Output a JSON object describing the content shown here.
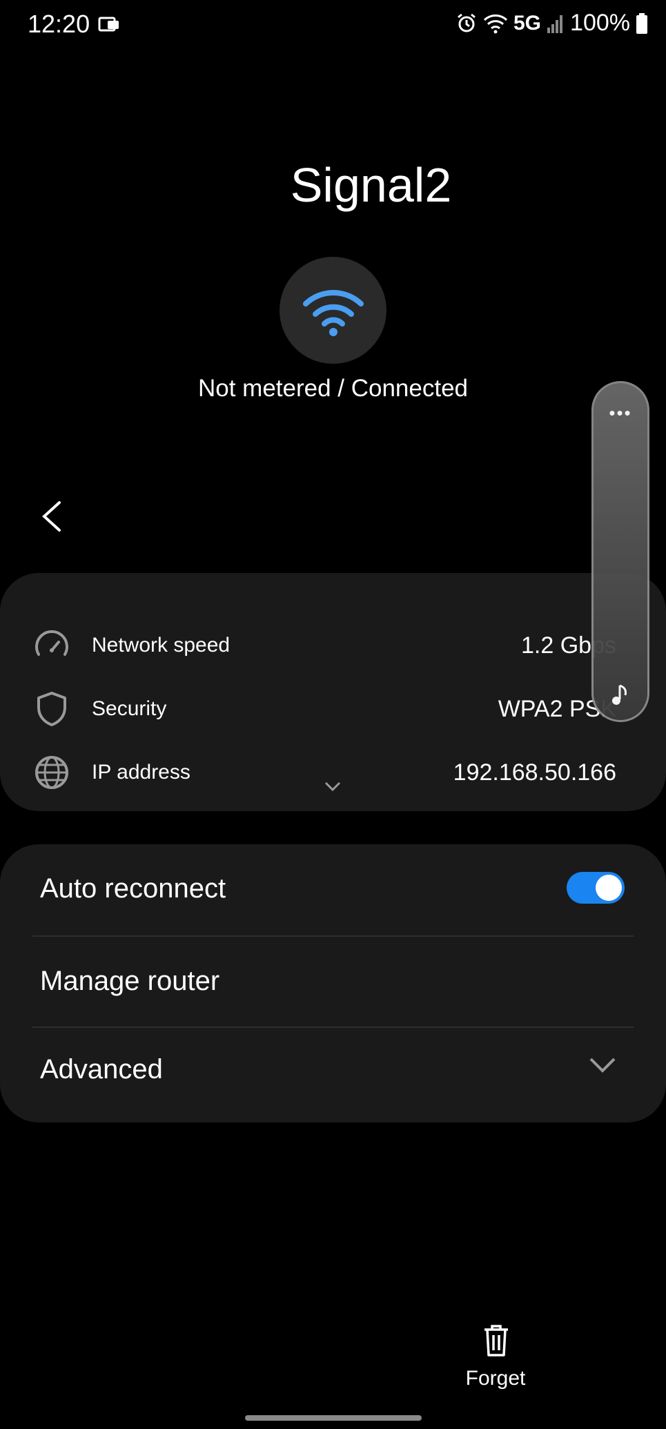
{
  "status_bar": {
    "time": "12:20",
    "network_type": "5G",
    "battery": "100%",
    "icons": [
      "notification-icon",
      "alarm-icon",
      "wifi-signal-icon",
      "cell-signal-icon",
      "battery-icon"
    ]
  },
  "network": {
    "name": "Signal2",
    "status": "Not metered / Connected",
    "accent_color": "#4a9ef0"
  },
  "info": {
    "rows": [
      {
        "label": "Network speed",
        "value": "1.2 Gbps",
        "icon": "speedometer-icon"
      },
      {
        "label": "Security",
        "value": "WPA2 PSK",
        "icon": "shield-icon"
      },
      {
        "label": "IP address",
        "value": "192.168.50.166",
        "icon": "globe-icon"
      }
    ]
  },
  "settings": {
    "auto_reconnect_label": "Auto reconnect",
    "auto_reconnect_on": true,
    "manage_router_label": "Manage router",
    "advanced_label": "Advanced",
    "toggle_color": "#1a84f0"
  },
  "footer": {
    "forget_label": "Forget"
  },
  "edge_panel": {
    "menu": "•••"
  }
}
